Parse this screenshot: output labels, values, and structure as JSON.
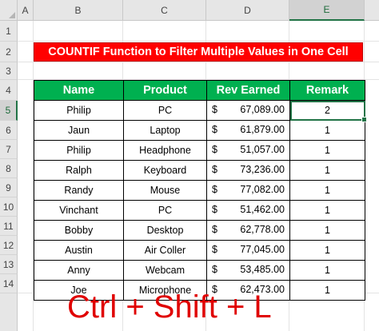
{
  "sheet": {
    "columns": [
      "A",
      "B",
      "C",
      "D",
      "E"
    ],
    "active_column": "E",
    "rows": [
      "1",
      "2",
      "3",
      "4",
      "5",
      "6",
      "7",
      "8",
      "9",
      "10",
      "11",
      "12",
      "13",
      "14"
    ],
    "active_row": "5"
  },
  "title": "COUNTIF Function to Filter Multiple Values in One Cell",
  "table": {
    "headers": [
      "Name",
      "Product",
      "Rev Earned",
      "Remark"
    ],
    "currency": "$",
    "rows": [
      {
        "name": "Philip",
        "product": "PC",
        "rev": "67,089.00",
        "remark": "2"
      },
      {
        "name": "Jaun",
        "product": "Laptop",
        "rev": "61,879.00",
        "remark": "1"
      },
      {
        "name": "Philip",
        "product": "Headphone",
        "rev": "51,057.00",
        "remark": "1"
      },
      {
        "name": "Ralph",
        "product": "Keyboard",
        "rev": "73,236.00",
        "remark": "1"
      },
      {
        "name": "Randy",
        "product": "Mouse",
        "rev": "77,082.00",
        "remark": "1"
      },
      {
        "name": "Vinchant",
        "product": "PC",
        "rev": "51,462.00",
        "remark": "1"
      },
      {
        "name": "Bobby",
        "product": "Desktop",
        "rev": "62,778.00",
        "remark": "1"
      },
      {
        "name": "Austin",
        "product": "Air Coller",
        "rev": "77,045.00",
        "remark": "1"
      },
      {
        "name": "Anny",
        "product": "Webcam",
        "rev": "53,485.00",
        "remark": "1"
      },
      {
        "name": "Joe",
        "product": "Microphone",
        "rev": "62,473.00",
        "remark": "1"
      }
    ]
  },
  "shortcut_text": "Ctrl + Shift + L",
  "colors": {
    "title_bg": "#ff0000",
    "header_bg": "#00b050",
    "selection": "#217346",
    "shortcut": "#e00000"
  }
}
